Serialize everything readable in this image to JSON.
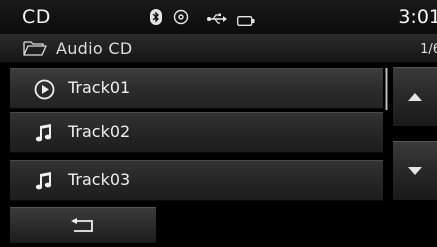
{
  "status_bar": {
    "title": "CD",
    "time": "3:01",
    "icons": [
      "bluetooth-icon",
      "disc-icon",
      "usb-icon",
      "battery-icon"
    ]
  },
  "header": {
    "icon": "folder-icon",
    "title": "Audio CD",
    "page": "1/6"
  },
  "tracks": [
    {
      "label": "Track01",
      "icon": "play-circle-icon",
      "playing": true
    },
    {
      "label": "Track02",
      "icon": "music-note-icon",
      "playing": false
    },
    {
      "label": "Track03",
      "icon": "music-note-icon",
      "playing": false
    }
  ],
  "controls": {
    "scroll_up_icon": "triangle-up-icon",
    "scroll_down_icon": "triangle-down-icon",
    "back_icon": "return-arrow-icon"
  },
  "colors": {
    "background": "#000000",
    "text": "#f2f2f2",
    "button": "#2a2a2a"
  }
}
